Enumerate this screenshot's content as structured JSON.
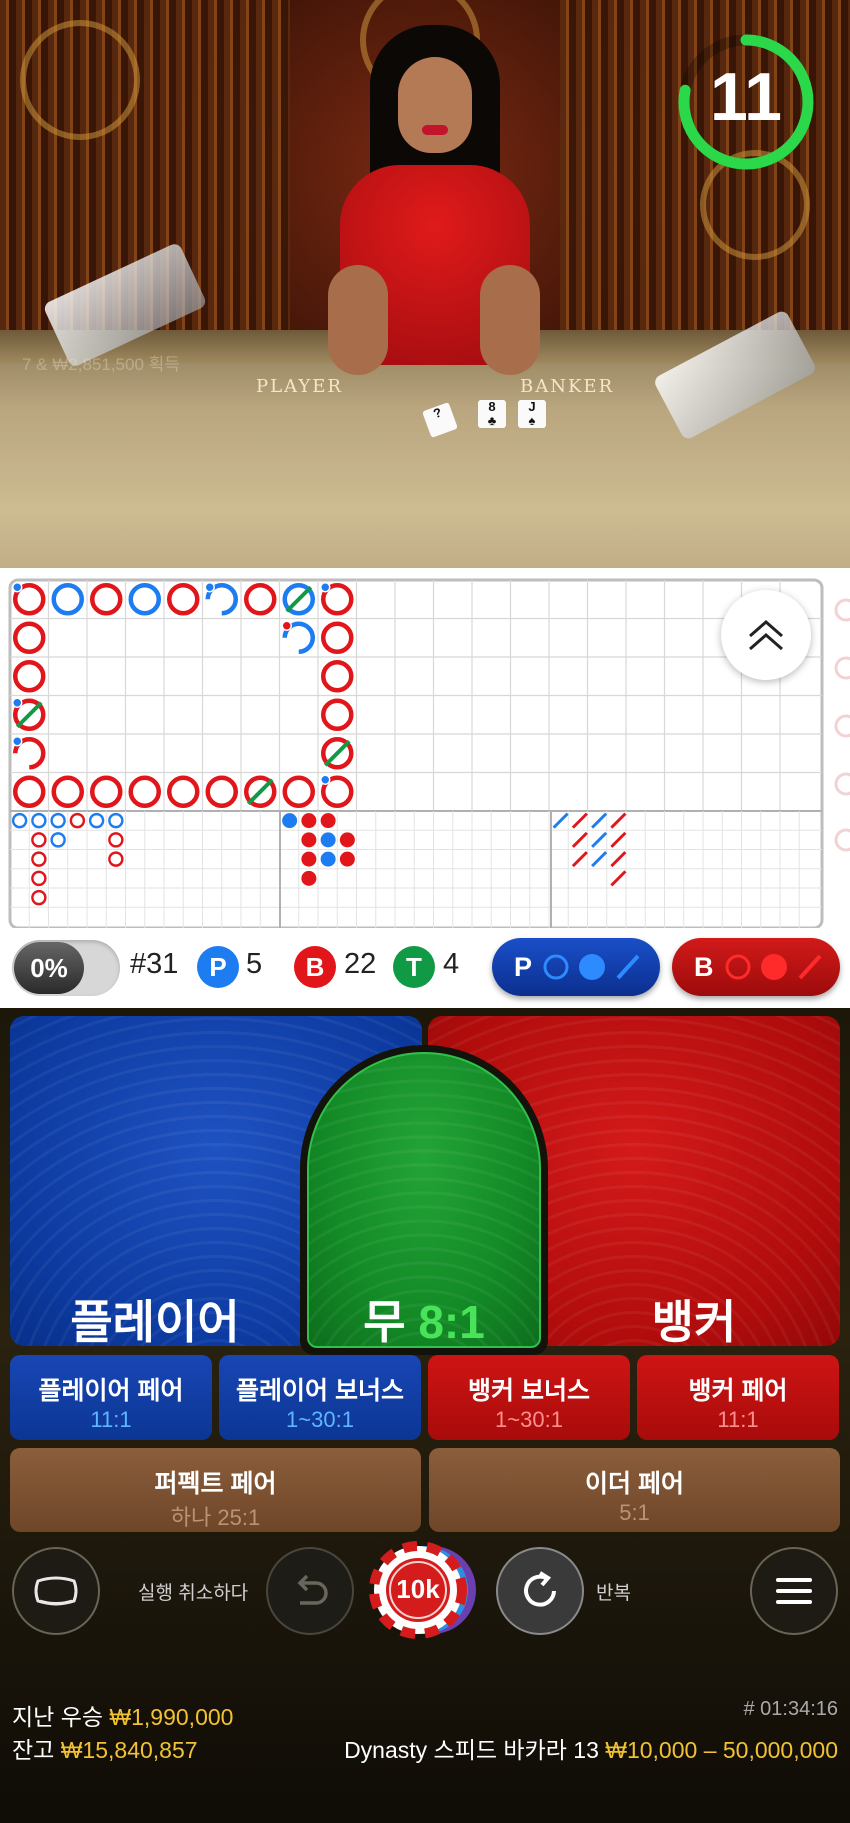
{
  "video": {
    "table_label_player": "PLAYER",
    "table_label_banker": "BANKER",
    "faint_overlay": "7 & ₩2,851,500 획득",
    "timer": {
      "seconds": "11",
      "fraction_remaining": 0.78,
      "color": "#2bd84a"
    }
  },
  "scoreboard": {
    "bead_road": [
      {
        "col": 0,
        "row": 0,
        "o": "B",
        "dot": "b"
      },
      {
        "col": 1,
        "row": 0,
        "o": "P"
      },
      {
        "col": 2,
        "row": 0,
        "o": "B"
      },
      {
        "col": 3,
        "row": 0,
        "o": "P"
      },
      {
        "col": 4,
        "row": 0,
        "o": "B"
      },
      {
        "col": 5,
        "row": 0,
        "o": "P",
        "dot": "b",
        "half": true
      },
      {
        "col": 6,
        "row": 0,
        "o": "B"
      },
      {
        "col": 7,
        "row": 0,
        "o": "P",
        "tie": true
      },
      {
        "col": 8,
        "row": 0,
        "o": "B",
        "dot": "b"
      },
      {
        "col": 0,
        "row": 1,
        "o": "B"
      },
      {
        "col": 7,
        "row": 1,
        "o": "P",
        "dot": "r",
        "half": true
      },
      {
        "col": 8,
        "row": 1,
        "o": "B"
      },
      {
        "col": 0,
        "row": 2,
        "o": "B"
      },
      {
        "col": 8,
        "row": 2,
        "o": "B"
      },
      {
        "col": 0,
        "row": 3,
        "o": "B",
        "tie": true,
        "dot": "b"
      },
      {
        "col": 8,
        "row": 3,
        "o": "B"
      },
      {
        "col": 0,
        "row": 4,
        "o": "B",
        "dot": "b",
        "half": true
      },
      {
        "col": 8,
        "row": 4,
        "o": "B",
        "tie": true
      },
      {
        "col": 0,
        "row": 5,
        "o": "B"
      },
      {
        "col": 1,
        "row": 5,
        "o": "B"
      },
      {
        "col": 2,
        "row": 5,
        "o": "B"
      },
      {
        "col": 3,
        "row": 5,
        "o": "B"
      },
      {
        "col": 4,
        "row": 5,
        "o": "B"
      },
      {
        "col": 5,
        "row": 5,
        "o": "B"
      },
      {
        "col": 6,
        "row": 5,
        "o": "B",
        "tie": true
      },
      {
        "col": 7,
        "row": 5,
        "o": "B"
      },
      {
        "col": 8,
        "row": 5,
        "o": "B",
        "dot": "b"
      }
    ],
    "big_eye_road": [
      {
        "c": 0,
        "r": 0,
        "o": "P"
      },
      {
        "c": 1,
        "r": 0,
        "o": "P"
      },
      {
        "c": 2,
        "r": 0,
        "o": "P"
      },
      {
        "c": 3,
        "r": 0,
        "o": "B"
      },
      {
        "c": 4,
        "r": 0,
        "o": "P"
      },
      {
        "c": 5,
        "r": 0,
        "o": "P"
      },
      {
        "c": 1,
        "r": 1,
        "o": "B"
      },
      {
        "c": 2,
        "r": 1,
        "o": "P"
      },
      {
        "c": 5,
        "r": 1,
        "o": "B"
      },
      {
        "c": 1,
        "r": 2,
        "o": "B"
      },
      {
        "c": 5,
        "r": 2,
        "o": "B"
      },
      {
        "c": 1,
        "r": 3,
        "o": "B"
      },
      {
        "c": 1,
        "r": 4,
        "o": "B"
      }
    ],
    "small_road": [
      {
        "c": 0,
        "r": 0,
        "o": "P"
      },
      {
        "c": 1,
        "r": 0,
        "o": "B"
      },
      {
        "c": 2,
        "r": 0,
        "o": "B"
      },
      {
        "c": 1,
        "r": 1,
        "o": "B"
      },
      {
        "c": 2,
        "r": 1,
        "o": "P"
      },
      {
        "c": 3,
        "r": 1,
        "o": "B"
      },
      {
        "c": 1,
        "r": 2,
        "o": "B"
      },
      {
        "c": 2,
        "r": 2,
        "o": "P"
      },
      {
        "c": 3,
        "r": 2,
        "o": "B"
      },
      {
        "c": 1,
        "r": 3,
        "o": "B"
      }
    ],
    "cockroach_road": [
      {
        "c": 0,
        "r": 0,
        "o": "P"
      },
      {
        "c": 1,
        "r": 0,
        "o": "B"
      },
      {
        "c": 2,
        "r": 0,
        "o": "P"
      },
      {
        "c": 3,
        "r": 0,
        "o": "B"
      },
      {
        "c": 1,
        "r": 1,
        "o": "B"
      },
      {
        "c": 2,
        "r": 1,
        "o": "P"
      },
      {
        "c": 3,
        "r": 1,
        "o": "B"
      },
      {
        "c": 1,
        "r": 2,
        "o": "B"
      },
      {
        "c": 2,
        "r": 2,
        "o": "P"
      },
      {
        "c": 3,
        "r": 2,
        "o": "B"
      },
      {
        "c": 3,
        "r": 3,
        "o": "B"
      }
    ]
  },
  "stats": {
    "percent": "0%",
    "round": "#31",
    "player_letter": "P",
    "player_count": "5",
    "banker_letter": "B",
    "banker_count": "22",
    "tie_letter": "T",
    "tie_count": "4",
    "predict_player": "P",
    "predict_banker": "B",
    "colors": {
      "player": "#1c7cf0",
      "banker": "#e0161b",
      "tie": "#119a45"
    }
  },
  "bets": {
    "player_label": "플레이어",
    "tie_label": "무",
    "tie_odds": "8:1",
    "banker_label": "뱅커",
    "side": [
      {
        "label": "플레이어 페어",
        "odds": "11:1"
      },
      {
        "label": "플레이어 보너스",
        "odds": "1~30:1"
      },
      {
        "label": "뱅커 보너스",
        "odds": "1~30:1"
      },
      {
        "label": "뱅커 페어",
        "odds": "11:1"
      }
    ],
    "pairs": [
      {
        "label": "퍼펙트 페어",
        "odds": "하나 25:1"
      },
      {
        "label": "이더 페어",
        "odds": "5:1"
      }
    ]
  },
  "controls": {
    "undo_label": "실행 취소하다",
    "chip_value": "10k",
    "repeat_label": "반복"
  },
  "footer": {
    "last_win_label": "지난 우승",
    "last_win_value": "₩1,990,000",
    "balance_label": "잔고",
    "balance_value": "₩15,840,857",
    "game_id": "# 01:34:16",
    "table_name": "Dynasty 스피드 바카라 13",
    "limits": "₩10,000 – 50,000,000"
  }
}
